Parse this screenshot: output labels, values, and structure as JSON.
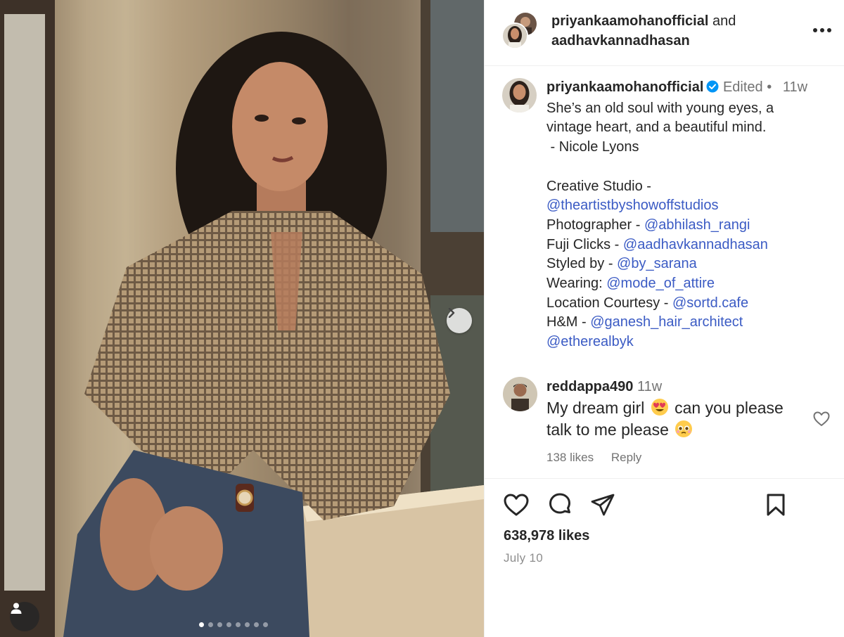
{
  "post": {
    "header": {
      "user1": "priyankaamohanofficial",
      "joiner": "and",
      "user2": "aadhavkannadhasan",
      "more_icon": "more-horizontal-icon"
    },
    "caption": {
      "username": "priyankaamohanofficial",
      "edited": "Edited",
      "separator": "•",
      "time": "11w",
      "quote_lines": [
        "She’s an old soul with young eyes, a",
        "vintage heart, and a beautiful mind.",
        " - Nicole Lyons"
      ],
      "credits": [
        {
          "label": "Creative Studio -",
          "mention": ""
        },
        {
          "label": "",
          "mention": "@theartistbyshowoffstudios"
        },
        {
          "label": "Photographer -",
          "mention": "@abhilash_rangi"
        },
        {
          "label": "Fuji Clicks -",
          "mention": "@aadhavkannadhasan"
        },
        {
          "label": "Styled by -",
          "mention": "@by_sarana"
        },
        {
          "label": "Wearing:",
          "mention": "@mode_of_attire"
        },
        {
          "label": "Location Courtesy -",
          "mention": "@sortd.cafe"
        },
        {
          "label": "H&M -",
          "mention": "@ganesh_hair_architect"
        },
        {
          "label": "",
          "mention": "@etherealbyk"
        }
      ]
    },
    "comment": {
      "username": "reddappa490",
      "time": "11w",
      "text_part1": "My dream girl",
      "text_part2": "can you please talk to me please",
      "emoji1": "heart-eyes-emoji",
      "emoji2": "pleading-face-emoji",
      "likes": "138 likes",
      "reply": "Reply"
    },
    "likes": "638,978 likes",
    "date": "July 10",
    "carousel": {
      "count": 8,
      "active_index": 0
    },
    "colors": {
      "mention": "#3b5bc4",
      "verified": "#0095f6",
      "meta": "#737373"
    }
  }
}
